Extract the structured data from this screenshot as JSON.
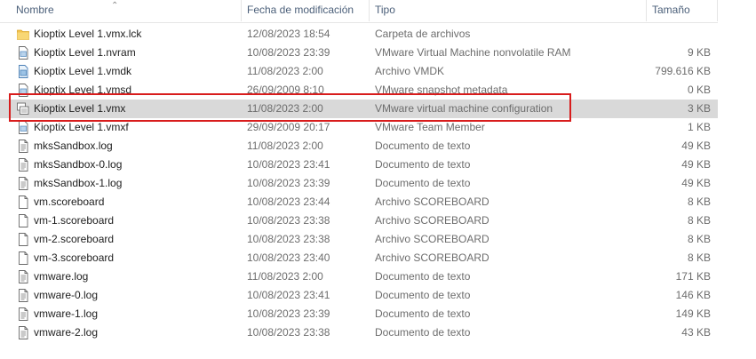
{
  "columns": {
    "name": "Nombre",
    "date": "Fecha de modificación",
    "type": "Tipo",
    "size": "Tamaño"
  },
  "files": [
    {
      "name": "Kioptix Level 1.vmx.lck",
      "date": "12/08/2023 18:54",
      "type": "Carpeta de archivos",
      "size": "",
      "icon": "folder-icon"
    },
    {
      "name": "Kioptix Level 1.nvram",
      "date": "10/08/2023 23:39",
      "type": "VMware Virtual Machine nonvolatile RAM",
      "size": "9 KB",
      "icon": "vmware-nvram-icon"
    },
    {
      "name": "Kioptix Level 1.vmdk",
      "date": "11/08/2023 2:00",
      "type": "Archivo VMDK",
      "size": "799.616 KB",
      "icon": "vmdk-file-icon"
    },
    {
      "name": "Kioptix Level 1.vmsd",
      "date": "26/09/2009 8:10",
      "type": "VMware snapshot metadata",
      "size": "0 KB",
      "icon": "vmware-snapshot-icon"
    },
    {
      "name": "Kioptix Level 1.vmx",
      "date": "11/08/2023 2:00",
      "type": "VMware virtual machine configuration",
      "size": "3 KB",
      "icon": "vmware-vm-icon",
      "selected": true
    },
    {
      "name": "Kioptix Level 1.vmxf",
      "date": "29/09/2009 20:17",
      "type": "VMware Team Member",
      "size": "1 KB",
      "icon": "vmware-team-icon"
    },
    {
      "name": "mksSandbox.log",
      "date": "11/08/2023 2:00",
      "type": "Documento de texto",
      "size": "49 KB",
      "icon": "text-document-icon"
    },
    {
      "name": "mksSandbox-0.log",
      "date": "10/08/2023 23:41",
      "type": "Documento de texto",
      "size": "49 KB",
      "icon": "text-document-icon"
    },
    {
      "name": "mksSandbox-1.log",
      "date": "10/08/2023 23:39",
      "type": "Documento de texto",
      "size": "49 KB",
      "icon": "text-document-icon"
    },
    {
      "name": "vm.scoreboard",
      "date": "10/08/2023 23:44",
      "type": "Archivo SCOREBOARD",
      "size": "8 KB",
      "icon": "blank-file-icon"
    },
    {
      "name": "vm-1.scoreboard",
      "date": "10/08/2023 23:38",
      "type": "Archivo SCOREBOARD",
      "size": "8 KB",
      "icon": "blank-file-icon"
    },
    {
      "name": "vm-2.scoreboard",
      "date": "10/08/2023 23:38",
      "type": "Archivo SCOREBOARD",
      "size": "8 KB",
      "icon": "blank-file-icon"
    },
    {
      "name": "vm-3.scoreboard",
      "date": "10/08/2023 23:40",
      "type": "Archivo SCOREBOARD",
      "size": "8 KB",
      "icon": "blank-file-icon"
    },
    {
      "name": "vmware.log",
      "date": "11/08/2023 2:00",
      "type": "Documento de texto",
      "size": "171 KB",
      "icon": "text-document-icon"
    },
    {
      "name": "vmware-0.log",
      "date": "10/08/2023 23:41",
      "type": "Documento de texto",
      "size": "146 KB",
      "icon": "text-document-icon"
    },
    {
      "name": "vmware-1.log",
      "date": "10/08/2023 23:39",
      "type": "Documento de texto",
      "size": "149 KB",
      "icon": "text-document-icon"
    },
    {
      "name": "vmware-2.log",
      "date": "10/08/2023 23:38",
      "type": "Documento de texto",
      "size": "43 KB",
      "icon": "text-document-icon"
    }
  ],
  "colors": {
    "highlight": "#d81c1c",
    "selected_row": "#d9d9d9",
    "folder": "#f4c34d"
  }
}
